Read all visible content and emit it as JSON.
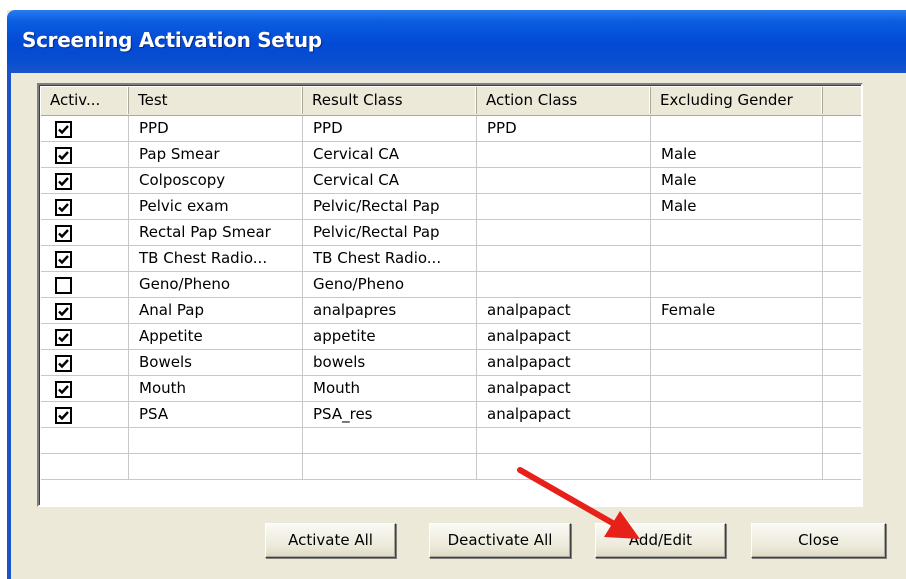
{
  "window": {
    "title": "Screening Activation Setup"
  },
  "grid": {
    "columns": [
      "Activ...",
      "Test",
      "Result Class",
      "Action Class",
      "Excluding Gender",
      ""
    ],
    "rows": [
      {
        "active": true,
        "test": "PPD",
        "result_class": "PPD",
        "action_class": "PPD",
        "excluding_gender": ""
      },
      {
        "active": true,
        "test": "Pap Smear",
        "result_class": "Cervical CA",
        "action_class": "",
        "excluding_gender": "Male"
      },
      {
        "active": true,
        "test": "Colposcopy",
        "result_class": "Cervical CA",
        "action_class": "",
        "excluding_gender": "Male"
      },
      {
        "active": true,
        "test": "Pelvic exam",
        "result_class": "Pelvic/Rectal Pap",
        "action_class": "",
        "excluding_gender": "Male"
      },
      {
        "active": true,
        "test": "Rectal Pap Smear",
        "result_class": "Pelvic/Rectal Pap",
        "action_class": "",
        "excluding_gender": ""
      },
      {
        "active": true,
        "test": "TB Chest Radio...",
        "result_class": "TB Chest Radio...",
        "action_class": "",
        "excluding_gender": ""
      },
      {
        "active": false,
        "test": "Geno/Pheno",
        "result_class": "Geno/Pheno",
        "action_class": "",
        "excluding_gender": ""
      },
      {
        "active": true,
        "test": "Anal Pap",
        "result_class": "analpapres",
        "action_class": "analpapact",
        "excluding_gender": "Female"
      },
      {
        "active": true,
        "test": "Appetite",
        "result_class": "appetite",
        "action_class": "analpapact",
        "excluding_gender": ""
      },
      {
        "active": true,
        "test": "Bowels",
        "result_class": "bowels",
        "action_class": "analpapact",
        "excluding_gender": ""
      },
      {
        "active": true,
        "test": "Mouth",
        "result_class": "Mouth",
        "action_class": "analpapact",
        "excluding_gender": ""
      },
      {
        "active": true,
        "test": "PSA",
        "result_class": "PSA_res",
        "action_class": "analpapact",
        "excluding_gender": ""
      }
    ]
  },
  "buttons": {
    "activate_all": "Activate All",
    "deactivate_all": "Deactivate All",
    "add_edit": "Add/Edit",
    "close": "Close"
  },
  "annotation": {
    "arrow_color": "#e8201a",
    "arrow_icon": "red-pointer-arrow-icon"
  },
  "colors": {
    "titlebar": "#0249d4",
    "dialog_bg": "#ece9d8"
  }
}
